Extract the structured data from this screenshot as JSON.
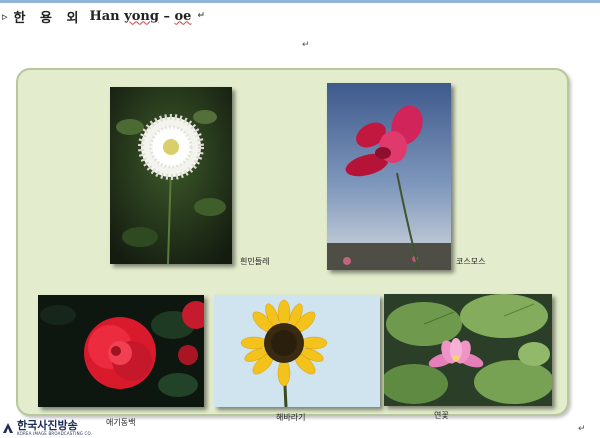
{
  "document": {
    "heading_bullet": "▹",
    "heading_korean": "한 용 외",
    "heading_roman_1": "Han",
    "heading_roman_2": "yong",
    "heading_roman_3": "–",
    "heading_roman_4": "oe",
    "paragraph_mark": "↵"
  },
  "photos": [
    {
      "caption": "흰민들레"
    },
    {
      "caption": "코스모스"
    },
    {
      "caption": "애기동백"
    },
    {
      "caption": "해바라기"
    },
    {
      "caption": "연꽃"
    }
  ],
  "watermark": {
    "name": "한국사진방송",
    "subtitle": "KOREA IMAGE BROADCASTING CO."
  },
  "colors": {
    "panel_background": "#e3eccc",
    "panel_border": "#b8c79c",
    "rule": "#8fb4d9"
  }
}
